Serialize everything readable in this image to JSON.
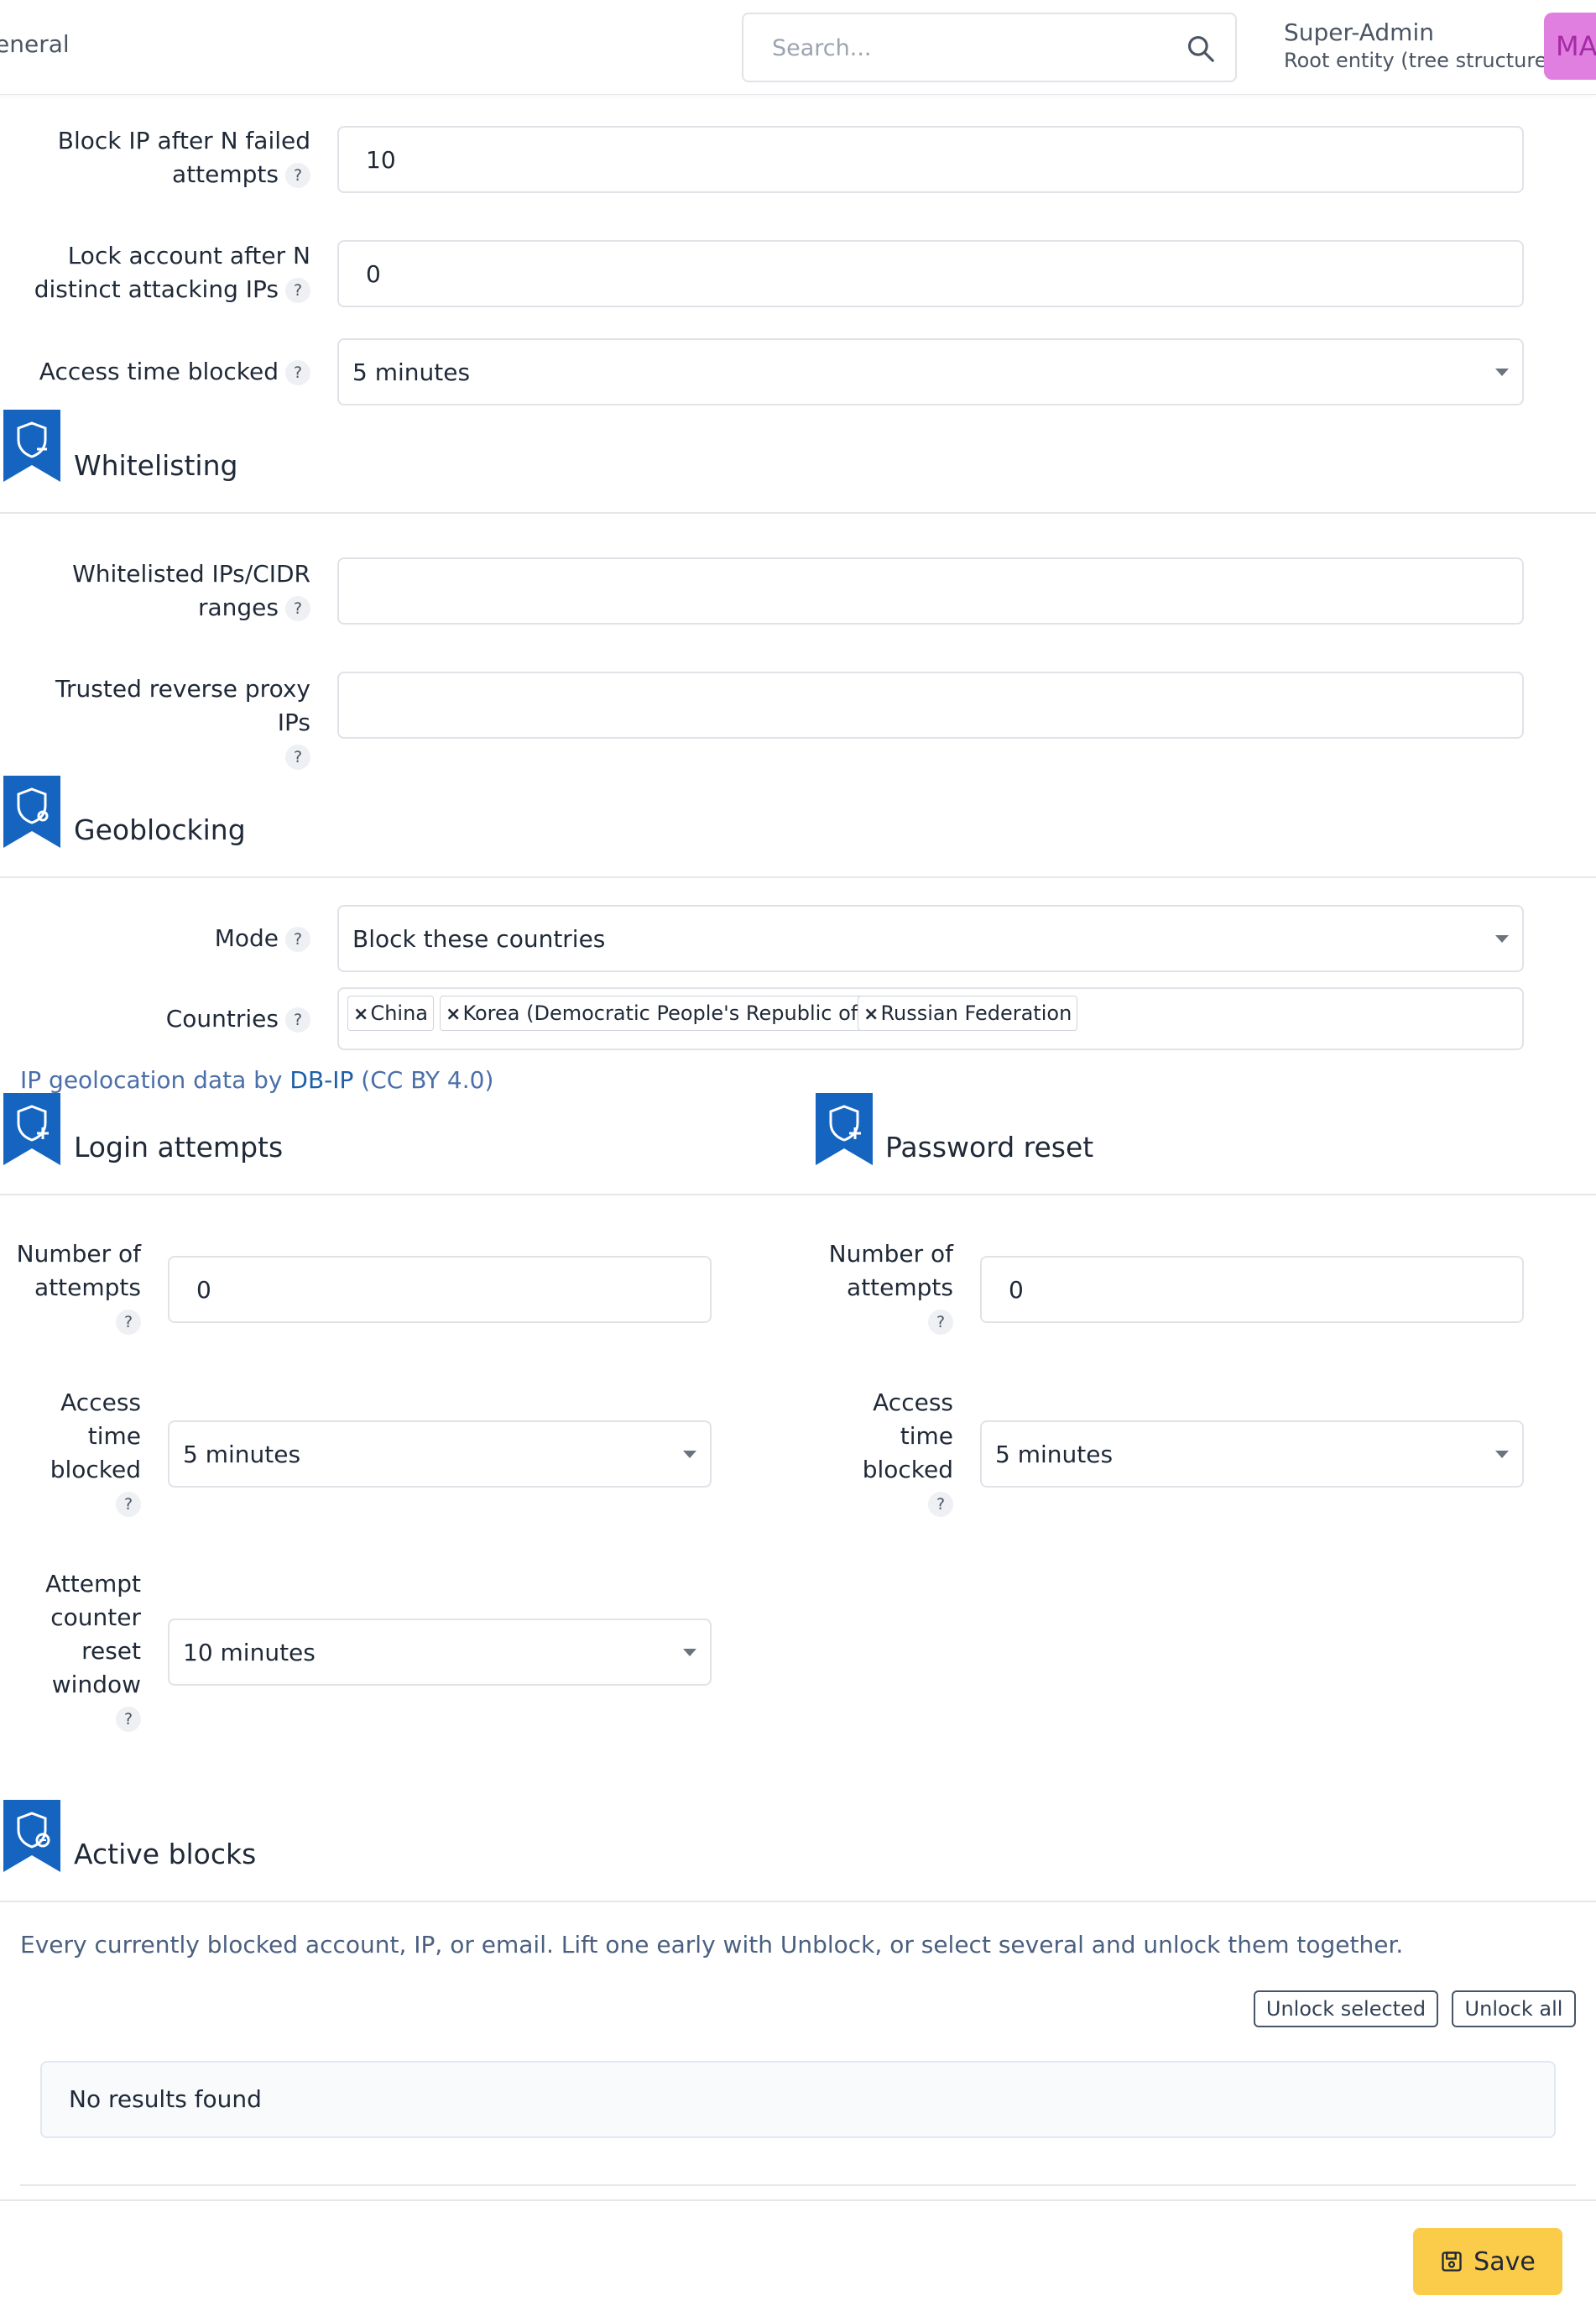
{
  "header": {
    "breadcrumb": "eneral",
    "search_placeholder": "Search...",
    "user_name": "Super-Admin",
    "user_entity": "Root entity (tree structure)",
    "avatar_initials": "MA",
    "avatar_color": "#e07fdf"
  },
  "brute_force": {
    "block_ip_label_1": "Block IP after N failed",
    "block_ip_label_2": "attempts",
    "block_ip_value": "10",
    "lock_account_label_1": "Lock account after N",
    "lock_account_label_2": "distinct attacking IPs",
    "lock_account_value": "0",
    "access_time_label": "Access time blocked",
    "access_time_value": "5 minutes"
  },
  "whitelisting": {
    "title": "Whitelisting",
    "ips_label_1": "Whitelisted IPs/CIDR",
    "ips_label_2": "ranges",
    "ips_value": "",
    "proxy_label": "Trusted reverse proxy IPs",
    "proxy_value": ""
  },
  "geoblocking": {
    "title": "Geoblocking",
    "mode_label": "Mode",
    "mode_value": "Block these countries",
    "countries_label": "Countries",
    "countries": [
      "China",
      "Korea (Democratic People's Republic of)",
      "Russian Federation"
    ],
    "note_prefix": "IP geolocation data by ",
    "note_link": "DB-IP",
    "note_suffix": " (CC BY 4.0)"
  },
  "login_attempts": {
    "title": "Login attempts",
    "attempts_label": [
      "Number of",
      "attempts"
    ],
    "attempts_value": "0",
    "access_label": [
      "Access",
      "time",
      "blocked"
    ],
    "access_value": "5 minutes",
    "reset_label": [
      "Attempt",
      "counter",
      "reset",
      "window"
    ],
    "reset_value": "10 minutes"
  },
  "password_reset": {
    "title": "Password reset",
    "attempts_label": [
      "Number of",
      "attempts"
    ],
    "attempts_value": "0",
    "access_label": [
      "Access",
      "time",
      "blocked"
    ],
    "access_value": "5 minutes"
  },
  "active_blocks": {
    "title": "Active blocks",
    "description": "Every currently blocked account, IP, or email. Lift one early with Unblock, or select several and unlock them together.",
    "unlock_selected": "Unlock selected",
    "unlock_all": "Unlock all",
    "empty_text": "No results found"
  },
  "help_glyph": "?",
  "tag_remove_glyph": "×",
  "save_label": "Save",
  "colors": {
    "ribbon": "#1565c0",
    "save_button": "#fbcb4a",
    "link": "#1d5fa8"
  }
}
